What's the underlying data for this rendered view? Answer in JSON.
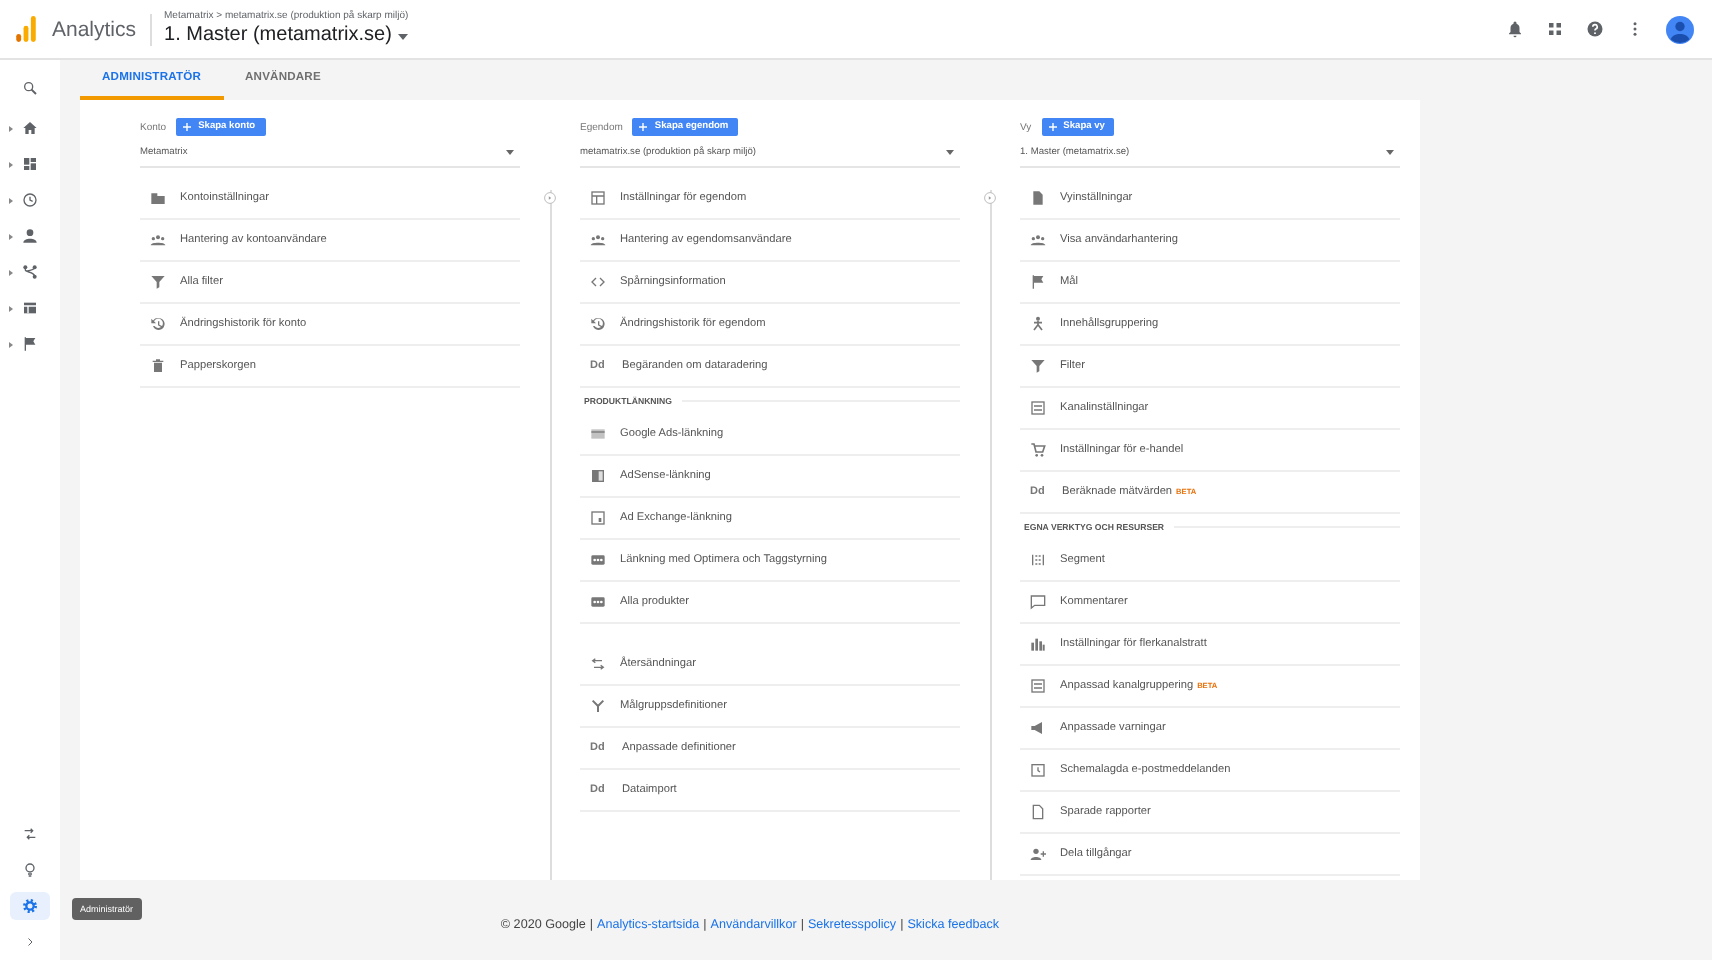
{
  "header": {
    "product": "Analytics",
    "breadcrumb": "Metamatrix > metamatrix.se (produktion på skarp miljö)",
    "title": "1. Master (metamatrix.se)"
  },
  "sidebar": {
    "top_items": [
      {
        "selected": false
      },
      {
        "selected": false,
        "expanded": false
      },
      {
        "selected": false,
        "expanded": false
      },
      {
        "selected": false,
        "expanded": false
      },
      {
        "selected": false,
        "expanded": false
      },
      {
        "selected": false,
        "expanded": false
      },
      {
        "selected": false,
        "expanded": false
      },
      {
        "selected": false,
        "expanded": false
      }
    ],
    "bottom_items": [
      {
        "selected": false
      },
      {
        "selected": false
      },
      {
        "selected": true
      }
    ],
    "tooltip": "Administratör"
  },
  "tabs": [
    {
      "label": "ADMINISTRATÖR",
      "selected": true
    },
    {
      "label": "ANVÄNDARE",
      "selected": false
    }
  ],
  "columns": [
    {
      "label": "Konto",
      "create_button": "Skapa konto",
      "selector": "Metamatrix",
      "sections": [
        {
          "items": [
            {
              "label": "Kontoinställningar"
            },
            {
              "label": "Hantering av kontoanvändare"
            },
            {
              "label": "Alla filter"
            },
            {
              "label": "Ändringshistorik för konto"
            },
            {
              "label": "Papperskorgen"
            }
          ]
        }
      ]
    },
    {
      "label": "Egendom",
      "create_button": "Skapa egendom",
      "selector": "metamatrix.se (produktion på skarp miljö)",
      "sections": [
        {
          "items": [
            {
              "label": "Inställningar för egendom"
            },
            {
              "label": "Hantering av egendomsanvändare"
            },
            {
              "label": "Spårningsinformation"
            },
            {
              "label": "Ändringshistorik för egendom"
            },
            {
              "label": "Begäranden om dataradering",
              "icon_text": "Dd"
            }
          ]
        },
        {
          "heading": "PRODUKTLÄNKNING",
          "items": [
            {
              "label": "Google Ads-länkning"
            },
            {
              "label": "AdSense-länkning"
            },
            {
              "label": "Ad Exchange-länkning"
            },
            {
              "label": "Länkning med Optimera och Taggstyrning"
            },
            {
              "label": "Alla produkter"
            }
          ]
        },
        {
          "items": [
            {
              "label": "Återsändningar"
            },
            {
              "label": "Målgruppsdefinitioner"
            },
            {
              "label": "Anpassade definitioner",
              "icon_text": "Dd"
            },
            {
              "label": "Dataimport",
              "icon_text": "Dd"
            }
          ]
        }
      ]
    },
    {
      "label": "Vy",
      "create_button": "Skapa vy",
      "selector": "1. Master (metamatrix.se)",
      "sections": [
        {
          "items": [
            {
              "label": "Vyinställningar"
            },
            {
              "label": "Visa användarhantering"
            },
            {
              "label": "Mål"
            },
            {
              "label": "Innehållsgruppering"
            },
            {
              "label": "Filter"
            },
            {
              "label": "Kanalinställningar"
            },
            {
              "label": "Inställningar för e-handel"
            },
            {
              "label": "Beräknade mätvärden",
              "icon_text": "Dd",
              "badge": "BETA"
            }
          ]
        },
        {
          "heading": "EGNA VERKTYG OCH RESURSER",
          "items": [
            {
              "label": "Segment"
            },
            {
              "label": "Kommentarer"
            },
            {
              "label": "Inställningar för flerkanalstratt"
            },
            {
              "label": "Anpassad kanalgruppering",
              "badge": "BETA"
            },
            {
              "label": "Anpassade varningar"
            },
            {
              "label": "Schemalagda e-postmeddelanden"
            },
            {
              "label": "Sparade rapporter"
            },
            {
              "label": "Dela tillgångar"
            }
          ]
        }
      ]
    }
  ],
  "footer": [
    {
      "kind": "text",
      "text": "© 2020 Google"
    },
    {
      "kind": "separator",
      "text": "|"
    },
    {
      "kind": "link",
      "text": "Analytics-startsida"
    },
    {
      "kind": "separator",
      "text": "|"
    },
    {
      "kind": "link",
      "text": "Användarvillkor"
    },
    {
      "kind": "separator",
      "text": "|"
    },
    {
      "kind": "link",
      "text": "Sekretesspolicy"
    },
    {
      "kind": "separator",
      "text": "|"
    },
    {
      "kind": "link",
      "text": "Skicka feedback"
    }
  ]
}
